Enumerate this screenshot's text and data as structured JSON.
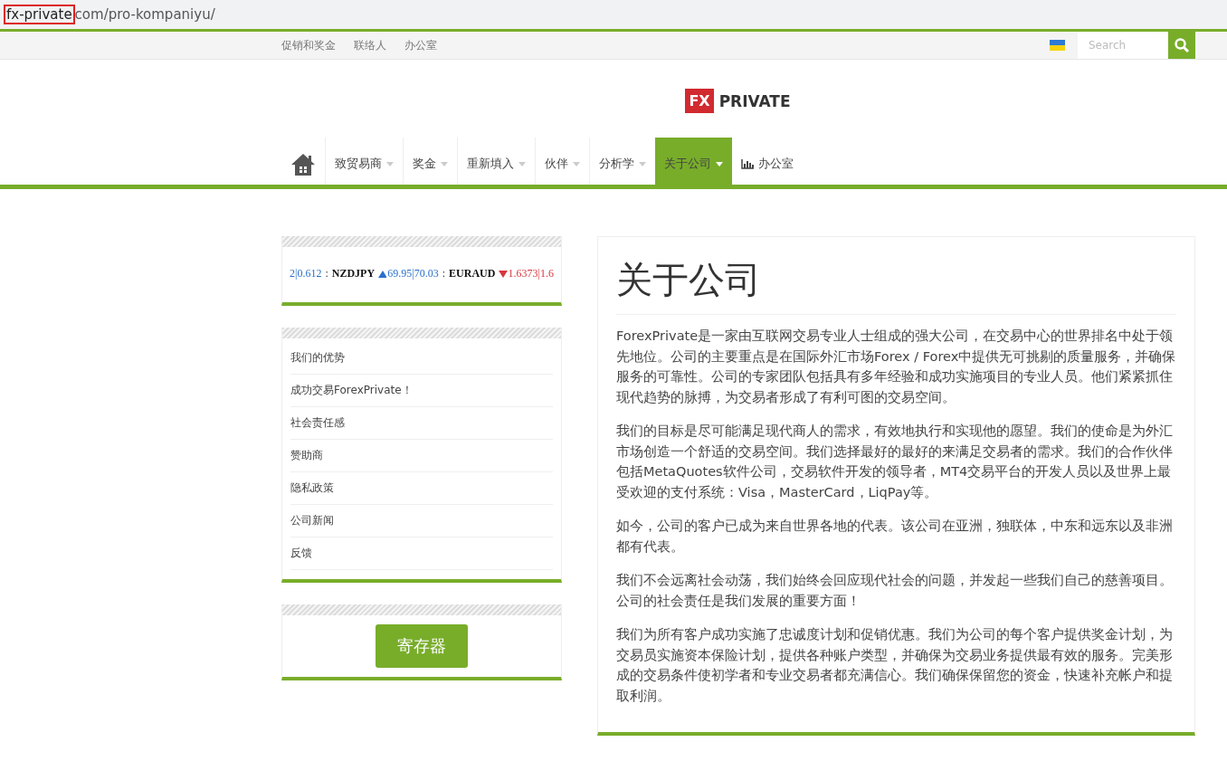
{
  "address_bar": {
    "host": "fx-private",
    "path": "com/pro-kompaniyu/"
  },
  "top_links": [
    "促销和奖金",
    "联络人",
    "办公室"
  ],
  "search": {
    "placeholder": "Search"
  },
  "logo": {
    "badge": "FX",
    "name": "PRIVATE"
  },
  "nav": [
    {
      "kind": "home",
      "selected": false
    },
    {
      "kind": "menu",
      "label": "致贸易商",
      "selected": false
    },
    {
      "kind": "menu",
      "label": "奖金",
      "selected": false
    },
    {
      "kind": "menu",
      "label": "重新填入",
      "selected": false
    },
    {
      "kind": "menu",
      "label": "伙伴",
      "selected": false
    },
    {
      "kind": "menu",
      "label": "分析学",
      "selected": false
    },
    {
      "kind": "menu",
      "label": "关于公司",
      "selected": true
    },
    {
      "kind": "chart",
      "label": "办公室",
      "selected": false
    }
  ],
  "ticker": [
    {
      "kind": "price",
      "text": "2|0.612",
      "color": "#2a6fc9"
    },
    {
      "kind": "sep",
      "text": ":"
    },
    {
      "kind": "symbol",
      "text": "NZDJPY"
    },
    {
      "kind": "up_arrow",
      "color": "#2a6fc9"
    },
    {
      "kind": "price",
      "text": "69.95|70.03",
      "color": "#2a6fc9"
    },
    {
      "kind": "sep",
      "text": ":"
    },
    {
      "kind": "symbol",
      "text": "EURAUD"
    },
    {
      "kind": "down_arrow",
      "color": "#d9363e"
    },
    {
      "kind": "price",
      "text": "1.6373|1.6",
      "color": "#d9363e"
    }
  ],
  "side_menu": [
    "我们的优势",
    "成功交易ForexPrivate！",
    "社会责任感",
    "赞助商",
    "隐私政策",
    "公司新闻",
    "反馈"
  ],
  "register_button": "寄存器",
  "article": {
    "title": "关于公司",
    "paragraphs": [
      "ForexPrivate是一家由互联网交易专业人士组成的强大公司，在交易中心的世界排名中处于领先地位。公司的主要重点是在国际外汇市场Forex / Forex中提供无可挑剔的质量服务，并确保服务的可靠性。公司的专家团队包括具有多年经验和成功实施项目的专业人员。他们紧紧抓住现代趋势的脉搏，为交易者形成了有利可图的交易空间。",
      "我们的目标是尽可能满足现代商人的需求，有效地执行和实现他的愿望。我们的使命是为外汇市场创造一个舒适的交易空间。我们选择最好的最好的来满足交易者的需求。我们的合作伙伴包括MetaQuotes软件公司，交易软件开发的领导者，MT4交易平台的开发人员以及世界上最受欢迎的支付系统：Visa，MasterCard，LiqPay等。",
      "如今，公司的客户已成为来自世界各地的代表。该公司在亚洲，独联体，中东和远东以及非洲都有代表。",
      "我们不会远离社会动荡，我们始终会回应现代社会的问题，并发起一些我们自己的慈善项目。公司的社会责任是我们发展的重要方面！",
      "我们为所有客户成功实施了忠诚度计划和促销优惠。我们为公司的每个客户提供奖金计划，为交易员实施资本保险计划，提供各种账户类型，并确保为交易业务提供最有效的服务。完美形成的交易条件使初学者和专业交易者都充满信心。我们确保保留您的资金，快速补充帐户和提取利润。"
    ]
  }
}
